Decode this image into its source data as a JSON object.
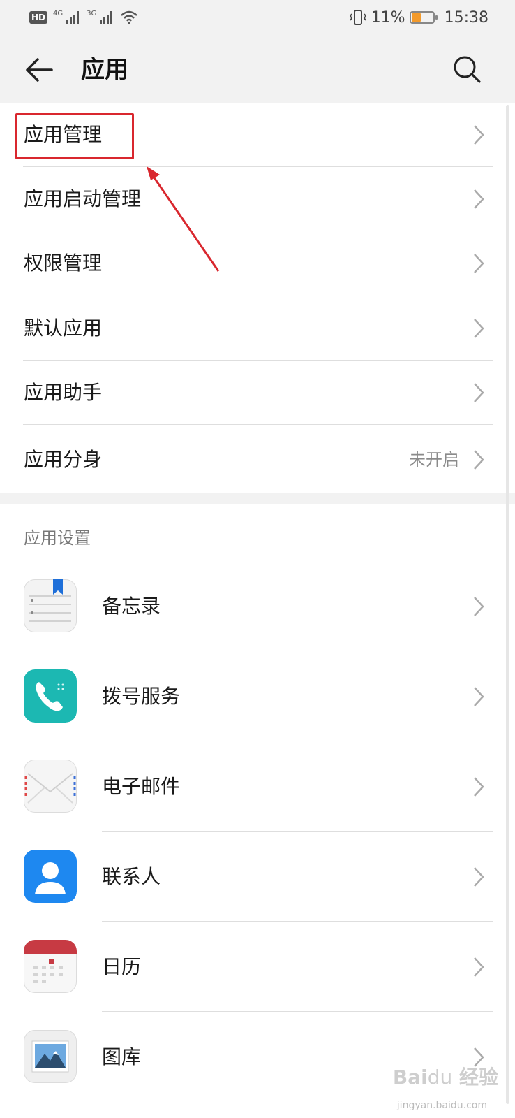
{
  "status_bar": {
    "hd": "HD",
    "net_1": "4G",
    "net_2": "3G",
    "battery_percent": "11%",
    "battery_level": 0.11,
    "time": "15:38"
  },
  "header": {
    "title": "应用",
    "back_icon": "arrow-left-icon",
    "search_icon": "search-icon"
  },
  "menu": {
    "items": [
      {
        "label": "应用管理"
      },
      {
        "label": "应用启动管理"
      },
      {
        "label": "权限管理"
      },
      {
        "label": "默认应用"
      },
      {
        "label": "应用助手"
      },
      {
        "label": "应用分身",
        "value": "未开启"
      }
    ]
  },
  "app_settings": {
    "header": "应用设置",
    "apps": [
      {
        "label": "备忘录",
        "icon": "notepad-icon"
      },
      {
        "label": "拨号服务",
        "icon": "phone-icon"
      },
      {
        "label": "电子邮件",
        "icon": "email-icon"
      },
      {
        "label": "联系人",
        "icon": "contacts-icon"
      },
      {
        "label": "日历",
        "icon": "calendar-icon"
      },
      {
        "label": "图库",
        "icon": "gallery-icon"
      }
    ]
  },
  "colors": {
    "highlight": "#d9272e",
    "battery": "#f39a2b",
    "phone_icon": "#1cb8b2",
    "contacts_icon": "#1e88f0",
    "calendar_icon": "#c73a43"
  }
}
